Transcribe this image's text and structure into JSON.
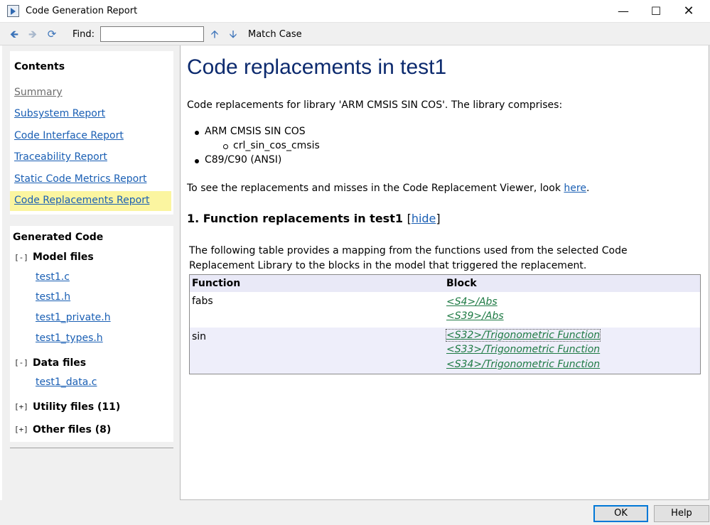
{
  "window": {
    "title": "Code Generation Report"
  },
  "toolbar": {
    "find_label": "Find:",
    "find_value": "",
    "match_case": "Match Case"
  },
  "contents": {
    "title": "Contents",
    "links": [
      {
        "label": "Summary",
        "state": "visited"
      },
      {
        "label": "Subsystem Report",
        "state": "normal"
      },
      {
        "label": "Code Interface Report",
        "state": "normal"
      },
      {
        "label": "Traceability Report",
        "state": "normal"
      },
      {
        "label": "Static Code Metrics Report",
        "state": "normal"
      },
      {
        "label": "Code Replacements Report",
        "state": "selected"
      }
    ]
  },
  "generated_code": {
    "title": "Generated Code",
    "groups": [
      {
        "toggle": "[-]",
        "label": "Model files",
        "files": [
          "test1.c",
          "test1.h",
          "test1_private.h",
          "test1_types.h"
        ]
      },
      {
        "toggle": "[-]",
        "label": "Data files",
        "files": [
          "test1_data.c"
        ]
      },
      {
        "toggle": "[+]",
        "label": "Utility files (11)",
        "files": []
      },
      {
        "toggle": "[+]",
        "label": "Other files (8)",
        "files": []
      }
    ]
  },
  "main": {
    "title": "Code replacements in test1",
    "intro": "Code replacements for library 'ARM CMSIS SIN COS'. The library comprises:",
    "libraries": [
      {
        "name": "ARM CMSIS SIN COS",
        "children": [
          "crl_sin_cos_cmsis"
        ]
      },
      {
        "name": "C89/C90 (ANSI)",
        "children": []
      }
    ],
    "viewer_text": "To see the replacements and misses in the Code Replacement Viewer, look",
    "viewer_link": "here",
    "viewer_end": ".",
    "section_heading": "1. Function replacements in test1",
    "section_toggle_open": "[",
    "section_toggle": "hide",
    "section_toggle_close": "]",
    "table_desc": "The following table provides a mapping from the functions used from the selected Code Replacement Library to the blocks in the model that triggered the replacement.",
    "table": {
      "headers": [
        "Function",
        "Block"
      ],
      "rows": [
        {
          "function": "fabs",
          "blocks": [
            "<S4>/Abs",
            "<S39>/Abs"
          ]
        },
        {
          "function": "sin",
          "blocks": [
            "<S32>/Trigonometric Function",
            "<S33>/Trigonometric Function",
            "<S34>/Trigonometric Function"
          ]
        }
      ]
    }
  },
  "footer": {
    "ok": "OK",
    "help": "Help"
  }
}
